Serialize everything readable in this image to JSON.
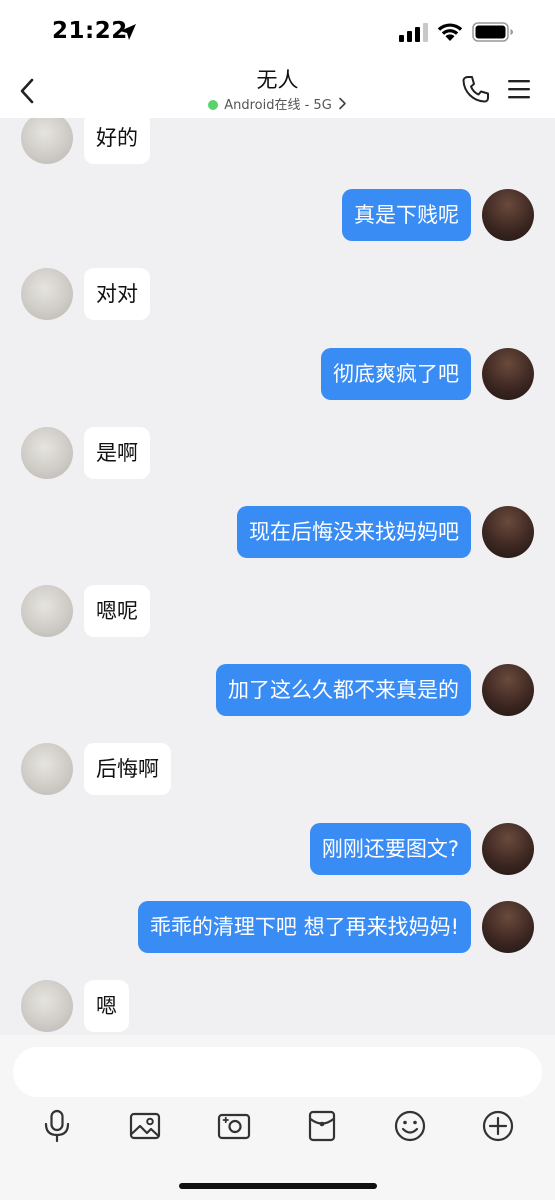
{
  "status_bar": {
    "time": "21:22",
    "icons": [
      "location-arrow-icon",
      "signal-icon",
      "wifi-icon",
      "battery-icon"
    ]
  },
  "header": {
    "title": "无人",
    "subtitle": "Android在线 - 5G",
    "status_dot_color": "#56d46b",
    "icons": [
      "back-icon",
      "phone-icon",
      "menu-icon"
    ]
  },
  "colors": {
    "sent_bubble": "#3a8cf5",
    "received_bubble": "#ffffff",
    "chat_background": "#f0f0f2"
  },
  "messages": [
    {
      "from": "other",
      "text": "好的"
    },
    {
      "from": "me",
      "text": "真是下贱呢"
    },
    {
      "from": "other",
      "text": "对对"
    },
    {
      "from": "me",
      "text": "彻底爽疯了吧"
    },
    {
      "from": "other",
      "text": "是啊"
    },
    {
      "from": "me",
      "text": "现在后悔没来找妈妈吧"
    },
    {
      "from": "other",
      "text": "嗯呢"
    },
    {
      "from": "me",
      "text": "加了这么久都不来真是的"
    },
    {
      "from": "other",
      "text": "后悔啊"
    },
    {
      "from": "me",
      "text": "刚刚还要图文?"
    },
    {
      "from": "me",
      "text": "乖乖的清理下吧 想了再来找妈妈!"
    },
    {
      "from": "other",
      "text": "嗯"
    }
  ],
  "input": {
    "value": "",
    "placeholder": ""
  },
  "toolbar": {
    "icons": [
      "microphone-icon",
      "photo-icon",
      "camera-icon",
      "red-packet-icon",
      "emoji-icon",
      "plus-icon"
    ]
  }
}
